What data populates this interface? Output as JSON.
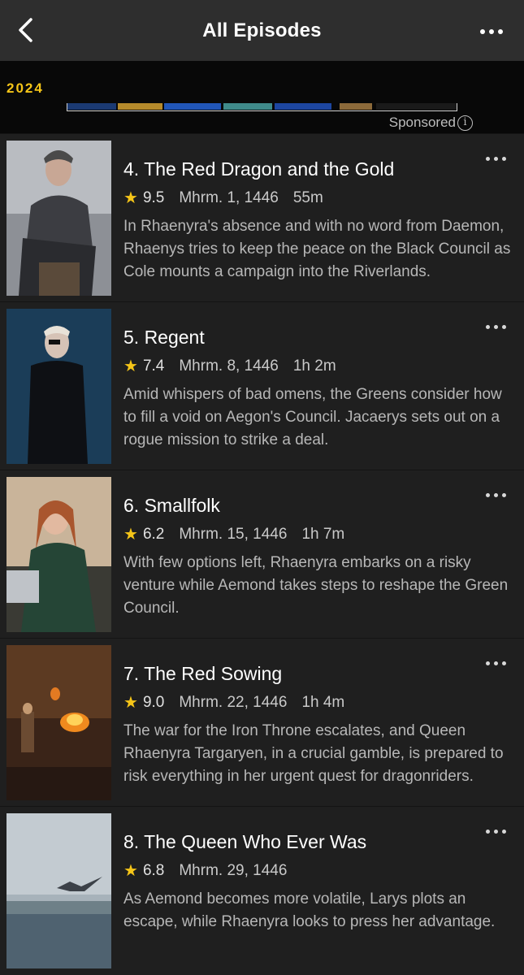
{
  "header": {
    "title": "All Episodes",
    "back_icon": "chevron-left-icon",
    "more_icon": "more-horizontal-icon"
  },
  "ad": {
    "year": "2024",
    "sponsored_label": "Sponsored",
    "info_glyph": "i"
  },
  "episodes": [
    {
      "title": "4. The Red Dragon and the Gold",
      "rating": "9.5",
      "date": "Mhrm. 1, 1446",
      "runtime": "55m",
      "description": "In Rhaenyra's absence and with no word from Daemon, Rhaenys tries to keep the peace on the Black Council as Cole mounts a campaign into the Riverlands."
    },
    {
      "title": "5. Regent",
      "rating": "7.4",
      "date": "Mhrm. 8, 1446",
      "runtime": "1h 2m",
      "description": "Amid whispers of bad omens, the Greens consider how to fill a void on Aegon's Council. Jacaerys sets out on a rogue mission to strike a deal."
    },
    {
      "title": "6. Smallfolk",
      "rating": "6.2",
      "date": "Mhrm. 15, 1446",
      "runtime": "1h 7m",
      "description": "With few options left, Rhaenyra embarks on a risky venture while Aemond takes steps to reshape the Green Council."
    },
    {
      "title": "7. The Red Sowing",
      "rating": "9.0",
      "date": "Mhrm. 22, 1446",
      "runtime": "1h 4m",
      "description": "The war for the Iron Throne escalates, and Queen Rhaenyra Targaryen, in a crucial gamble, is prepared to risk everything in her urgent quest for dragonriders."
    },
    {
      "title": "8. The Queen Who Ever Was",
      "rating": "6.8",
      "date": "Mhrm. 29, 1446",
      "runtime": "",
      "description": "As Aemond becomes more volatile, Larys plots an escape, while Rhaenyra looks to press her advantage."
    }
  ],
  "colors": {
    "accent_star": "#f5c518",
    "background": "#1f1f1f",
    "header_bg": "#2e2e2e"
  }
}
